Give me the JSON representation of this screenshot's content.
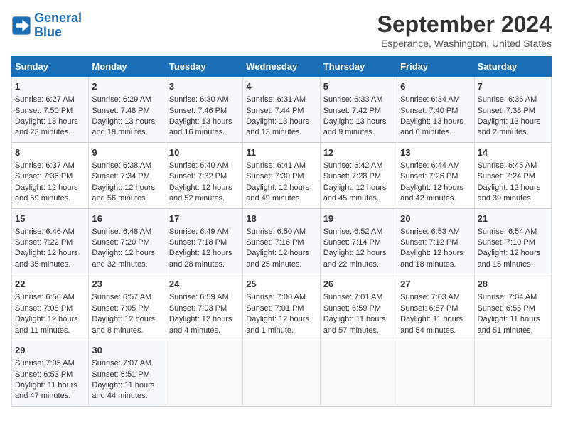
{
  "header": {
    "logo_line1": "General",
    "logo_line2": "Blue",
    "title": "September 2024",
    "subtitle": "Esperance, Washington, United States"
  },
  "days_of_week": [
    "Sunday",
    "Monday",
    "Tuesday",
    "Wednesday",
    "Thursday",
    "Friday",
    "Saturday"
  ],
  "weeks": [
    [
      {
        "day": "1",
        "lines": [
          "Sunrise: 6:27 AM",
          "Sunset: 7:50 PM",
          "Daylight: 13 hours",
          "and 23 minutes."
        ]
      },
      {
        "day": "2",
        "lines": [
          "Sunrise: 6:29 AM",
          "Sunset: 7:48 PM",
          "Daylight: 13 hours",
          "and 19 minutes."
        ]
      },
      {
        "day": "3",
        "lines": [
          "Sunrise: 6:30 AM",
          "Sunset: 7:46 PM",
          "Daylight: 13 hours",
          "and 16 minutes."
        ]
      },
      {
        "day": "4",
        "lines": [
          "Sunrise: 6:31 AM",
          "Sunset: 7:44 PM",
          "Daylight: 13 hours",
          "and 13 minutes."
        ]
      },
      {
        "day": "5",
        "lines": [
          "Sunrise: 6:33 AM",
          "Sunset: 7:42 PM",
          "Daylight: 13 hours",
          "and 9 minutes."
        ]
      },
      {
        "day": "6",
        "lines": [
          "Sunrise: 6:34 AM",
          "Sunset: 7:40 PM",
          "Daylight: 13 hours",
          "and 6 minutes."
        ]
      },
      {
        "day": "7",
        "lines": [
          "Sunrise: 6:36 AM",
          "Sunset: 7:38 PM",
          "Daylight: 13 hours",
          "and 2 minutes."
        ]
      }
    ],
    [
      {
        "day": "8",
        "lines": [
          "Sunrise: 6:37 AM",
          "Sunset: 7:36 PM",
          "Daylight: 12 hours",
          "and 59 minutes."
        ]
      },
      {
        "day": "9",
        "lines": [
          "Sunrise: 6:38 AM",
          "Sunset: 7:34 PM",
          "Daylight: 12 hours",
          "and 56 minutes."
        ]
      },
      {
        "day": "10",
        "lines": [
          "Sunrise: 6:40 AM",
          "Sunset: 7:32 PM",
          "Daylight: 12 hours",
          "and 52 minutes."
        ]
      },
      {
        "day": "11",
        "lines": [
          "Sunrise: 6:41 AM",
          "Sunset: 7:30 PM",
          "Daylight: 12 hours",
          "and 49 minutes."
        ]
      },
      {
        "day": "12",
        "lines": [
          "Sunrise: 6:42 AM",
          "Sunset: 7:28 PM",
          "Daylight: 12 hours",
          "and 45 minutes."
        ]
      },
      {
        "day": "13",
        "lines": [
          "Sunrise: 6:44 AM",
          "Sunset: 7:26 PM",
          "Daylight: 12 hours",
          "and 42 minutes."
        ]
      },
      {
        "day": "14",
        "lines": [
          "Sunrise: 6:45 AM",
          "Sunset: 7:24 PM",
          "Daylight: 12 hours",
          "and 39 minutes."
        ]
      }
    ],
    [
      {
        "day": "15",
        "lines": [
          "Sunrise: 6:46 AM",
          "Sunset: 7:22 PM",
          "Daylight: 12 hours",
          "and 35 minutes."
        ]
      },
      {
        "day": "16",
        "lines": [
          "Sunrise: 6:48 AM",
          "Sunset: 7:20 PM",
          "Daylight: 12 hours",
          "and 32 minutes."
        ]
      },
      {
        "day": "17",
        "lines": [
          "Sunrise: 6:49 AM",
          "Sunset: 7:18 PM",
          "Daylight: 12 hours",
          "and 28 minutes."
        ]
      },
      {
        "day": "18",
        "lines": [
          "Sunrise: 6:50 AM",
          "Sunset: 7:16 PM",
          "Daylight: 12 hours",
          "and 25 minutes."
        ]
      },
      {
        "day": "19",
        "lines": [
          "Sunrise: 6:52 AM",
          "Sunset: 7:14 PM",
          "Daylight: 12 hours",
          "and 22 minutes."
        ]
      },
      {
        "day": "20",
        "lines": [
          "Sunrise: 6:53 AM",
          "Sunset: 7:12 PM",
          "Daylight: 12 hours",
          "and 18 minutes."
        ]
      },
      {
        "day": "21",
        "lines": [
          "Sunrise: 6:54 AM",
          "Sunset: 7:10 PM",
          "Daylight: 12 hours",
          "and 15 minutes."
        ]
      }
    ],
    [
      {
        "day": "22",
        "lines": [
          "Sunrise: 6:56 AM",
          "Sunset: 7:08 PM",
          "Daylight: 12 hours",
          "and 11 minutes."
        ]
      },
      {
        "day": "23",
        "lines": [
          "Sunrise: 6:57 AM",
          "Sunset: 7:05 PM",
          "Daylight: 12 hours",
          "and 8 minutes."
        ]
      },
      {
        "day": "24",
        "lines": [
          "Sunrise: 6:59 AM",
          "Sunset: 7:03 PM",
          "Daylight: 12 hours",
          "and 4 minutes."
        ]
      },
      {
        "day": "25",
        "lines": [
          "Sunrise: 7:00 AM",
          "Sunset: 7:01 PM",
          "Daylight: 12 hours",
          "and 1 minute."
        ]
      },
      {
        "day": "26",
        "lines": [
          "Sunrise: 7:01 AM",
          "Sunset: 6:59 PM",
          "Daylight: 11 hours",
          "and 57 minutes."
        ]
      },
      {
        "day": "27",
        "lines": [
          "Sunrise: 7:03 AM",
          "Sunset: 6:57 PM",
          "Daylight: 11 hours",
          "and 54 minutes."
        ]
      },
      {
        "day": "28",
        "lines": [
          "Sunrise: 7:04 AM",
          "Sunset: 6:55 PM",
          "Daylight: 11 hours",
          "and 51 minutes."
        ]
      }
    ],
    [
      {
        "day": "29",
        "lines": [
          "Sunrise: 7:05 AM",
          "Sunset: 6:53 PM",
          "Daylight: 11 hours",
          "and 47 minutes."
        ]
      },
      {
        "day": "30",
        "lines": [
          "Sunrise: 7:07 AM",
          "Sunset: 6:51 PM",
          "Daylight: 11 hours",
          "and 44 minutes."
        ]
      },
      {
        "day": "",
        "lines": []
      },
      {
        "day": "",
        "lines": []
      },
      {
        "day": "",
        "lines": []
      },
      {
        "day": "",
        "lines": []
      },
      {
        "day": "",
        "lines": []
      }
    ]
  ]
}
